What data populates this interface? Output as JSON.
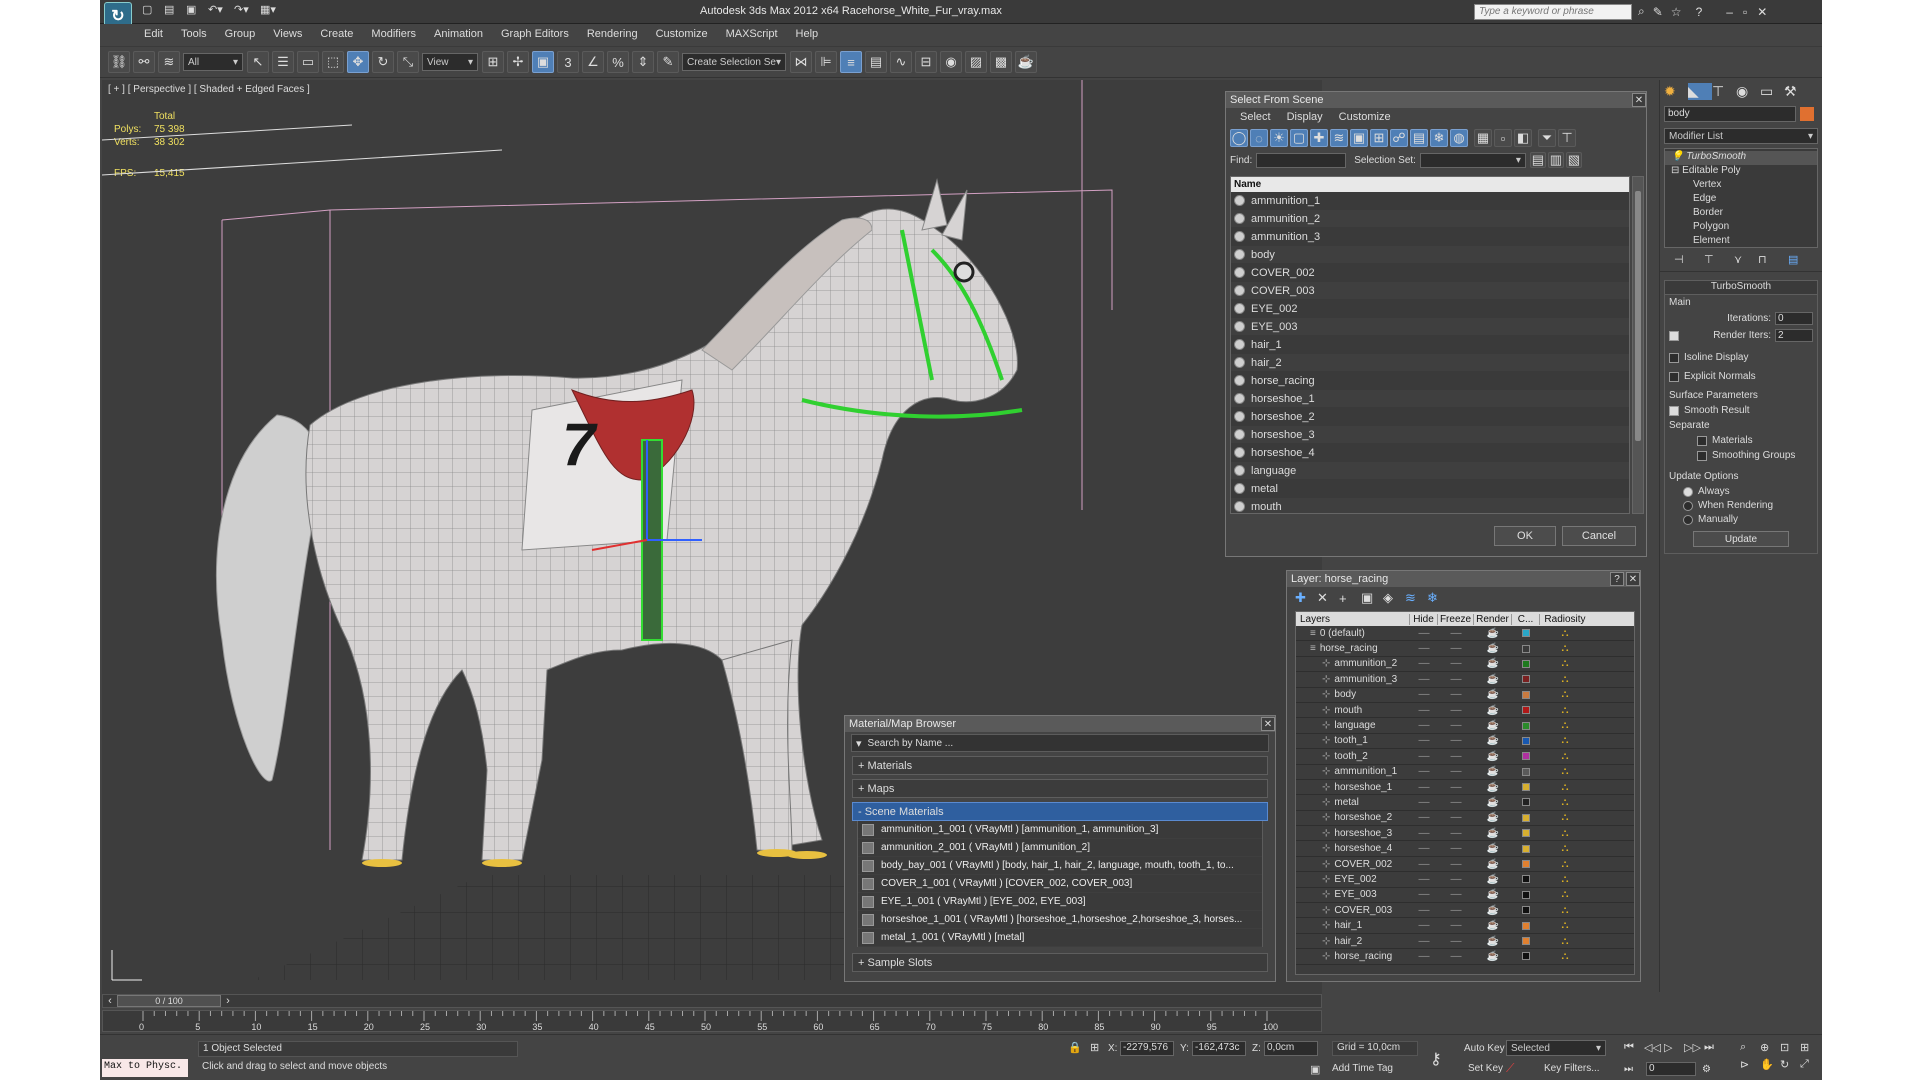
{
  "app": {
    "title": "Autodesk 3ds Max  2012 x64     Racehorse_White_Fur_vray.max",
    "search_placeholder": "Type a keyword or phrase"
  },
  "menu": [
    "Edit",
    "Tools",
    "Group",
    "Views",
    "Create",
    "Modifiers",
    "Animation",
    "Graph Editors",
    "Rendering",
    "Customize",
    "MAXScript",
    "Help"
  ],
  "toolbar": {
    "selection_filter": "All",
    "ref_coord": "View",
    "named_selection": "Create Selection Se",
    "numbers": {
      "snap": "3",
      "angle": "∠",
      "percent": "%"
    }
  },
  "viewport": {
    "label": "[ + ] [ Perspective ] [ Shaded + Edged Faces ]",
    "stats_header": "Total",
    "polys_label": "Polys:",
    "polys_value": "75 398",
    "verts_label": "Verts:",
    "verts_value": "38 302",
    "fps_label": "FPS:",
    "fps_value": "15,415",
    "saddle_number": "7"
  },
  "select_from_scene": {
    "title": "Select From Scene",
    "tabs": [
      "Select",
      "Display",
      "Customize"
    ],
    "find_label": "Find:",
    "selection_set_label": "Selection Set:",
    "column_name": "Name",
    "items": [
      "ammunition_1",
      "ammunition_2",
      "ammunition_3",
      "body",
      "COVER_002",
      "COVER_003",
      "EYE_002",
      "EYE_003",
      "hair_1",
      "hair_2",
      "horse_racing",
      "horseshoe_1",
      "horseshoe_2",
      "horseshoe_3",
      "horseshoe_4",
      "language",
      "metal",
      "mouth"
    ],
    "ok_label": "OK",
    "cancel_label": "Cancel"
  },
  "layer_dialog": {
    "title": "Layer: horse_racing",
    "help": "?",
    "columns": [
      "Layers",
      "Hide",
      "Freeze",
      "Render",
      "C...",
      "Radiosity"
    ],
    "rows": [
      {
        "name": "0 (default)",
        "indent": 0,
        "color": "#2aa7c8"
      },
      {
        "name": "horse_racing",
        "indent": 0,
        "color": "#3a3a3a"
      },
      {
        "name": "ammunition_2",
        "indent": 1,
        "color": "#1e7a1e"
      },
      {
        "name": "ammunition_3",
        "indent": 1,
        "color": "#7a2020"
      },
      {
        "name": "body",
        "indent": 1,
        "color": "#c87a40"
      },
      {
        "name": "mouth",
        "indent": 1,
        "color": "#b01818"
      },
      {
        "name": "language",
        "indent": 1,
        "color": "#2a8a2a"
      },
      {
        "name": "tooth_1",
        "indent": 1,
        "color": "#1858b0"
      },
      {
        "name": "tooth_2",
        "indent": 1,
        "color": "#b030a0"
      },
      {
        "name": "ammunition_1",
        "indent": 1,
        "color": "#5a5a5a"
      },
      {
        "name": "horseshoe_1",
        "indent": 1,
        "color": "#d8b030"
      },
      {
        "name": "metal",
        "indent": 1,
        "color": "#222222"
      },
      {
        "name": "horseshoe_2",
        "indent": 1,
        "color": "#d8b030"
      },
      {
        "name": "horseshoe_3",
        "indent": 1,
        "color": "#d8b030"
      },
      {
        "name": "horseshoe_4",
        "indent": 1,
        "color": "#d8b030"
      },
      {
        "name": "COVER_002",
        "indent": 1,
        "color": "#e08030"
      },
      {
        "name": "EYE_002",
        "indent": 1,
        "color": "#111111"
      },
      {
        "name": "EYE_003",
        "indent": 1,
        "color": "#111111"
      },
      {
        "name": "COVER_003",
        "indent": 1,
        "color": "#111111"
      },
      {
        "name": "hair_1",
        "indent": 1,
        "color": "#e08030"
      },
      {
        "name": "hair_2",
        "indent": 1,
        "color": "#e08030"
      },
      {
        "name": "horse_racing",
        "indent": 1,
        "color": "#111111"
      }
    ]
  },
  "material_browser": {
    "title": "Material/Map Browser",
    "search_placeholder": "Search by Name ...",
    "sections": {
      "materials": "+ Materials",
      "maps": "+ Maps",
      "scene": "- Scene Materials",
      "slots": "+ Sample Slots"
    },
    "scene_materials": [
      "ammunition_1_001  ( VRayMtl ) [ammunition_1, ammunition_3]",
      "ammunition_2_001  ( VRayMtl ) [ammunition_2]",
      "body_bay_001  ( VRayMtl ) [body, hair_1, hair_2, language, mouth, tooth_1, to...",
      "COVER_1_001  ( VRayMtl ) [COVER_002, COVER_003]",
      "EYE_1_001  ( VRayMtl ) [EYE_002, EYE_003]",
      "horseshoe_1_001  ( VRayMtl ) [horseshoe_1,horseshoe_2,horseshoe_3, horses...",
      "metal_1_001  ( VRayMtl ) [metal]"
    ]
  },
  "command_panel": {
    "object_name": "body",
    "object_color": "#e07030",
    "modifier_list": "Modifier List",
    "stack": [
      "TurboSmooth",
      "Editable Poly",
      "Vertex",
      "Edge",
      "Border",
      "Polygon",
      "Element"
    ],
    "rollout_title": "TurboSmooth",
    "main_label": "Main",
    "iterations_label": "Iterations:",
    "iterations_value": "0",
    "render_iters_label": "Render Iters:",
    "render_iters_value": "2",
    "isoline": "Isoline Display",
    "explicit": "Explicit Normals",
    "surface_params": "Surface Parameters",
    "smooth_result": "Smooth Result",
    "separate": "Separate",
    "materials": "Materials",
    "smoothing_groups": "Smoothing Groups",
    "update_options": "Update Options",
    "always": "Always",
    "when_rendering": "When Rendering",
    "manually": "Manually",
    "update": "Update"
  },
  "timeline": {
    "frame": "0 / 100",
    "ticks": [
      "0",
      "5",
      "10",
      "15",
      "20",
      "25",
      "30",
      "35",
      "40",
      "45",
      "50",
      "55",
      "60",
      "65",
      "70",
      "75",
      "80",
      "85",
      "90",
      "95",
      "100"
    ]
  },
  "status": {
    "maxscript": "Max to Physc.",
    "selected": "1 Object Selected",
    "prompt": "Click and drag to select and move objects",
    "x_label": "X:",
    "x_value": "-2279,576",
    "y_label": "Y:",
    "y_value": "-162,473c",
    "z_label": "Z:",
    "z_value": "0,0cm",
    "grid": "Grid = 10,0cm",
    "add_time_tag": "Add Time Tag",
    "auto_key": "Auto Key",
    "selected_mode": "Selected",
    "set_key": "Set Key",
    "key_filters": "Key Filters...",
    "frame_value": "0"
  }
}
